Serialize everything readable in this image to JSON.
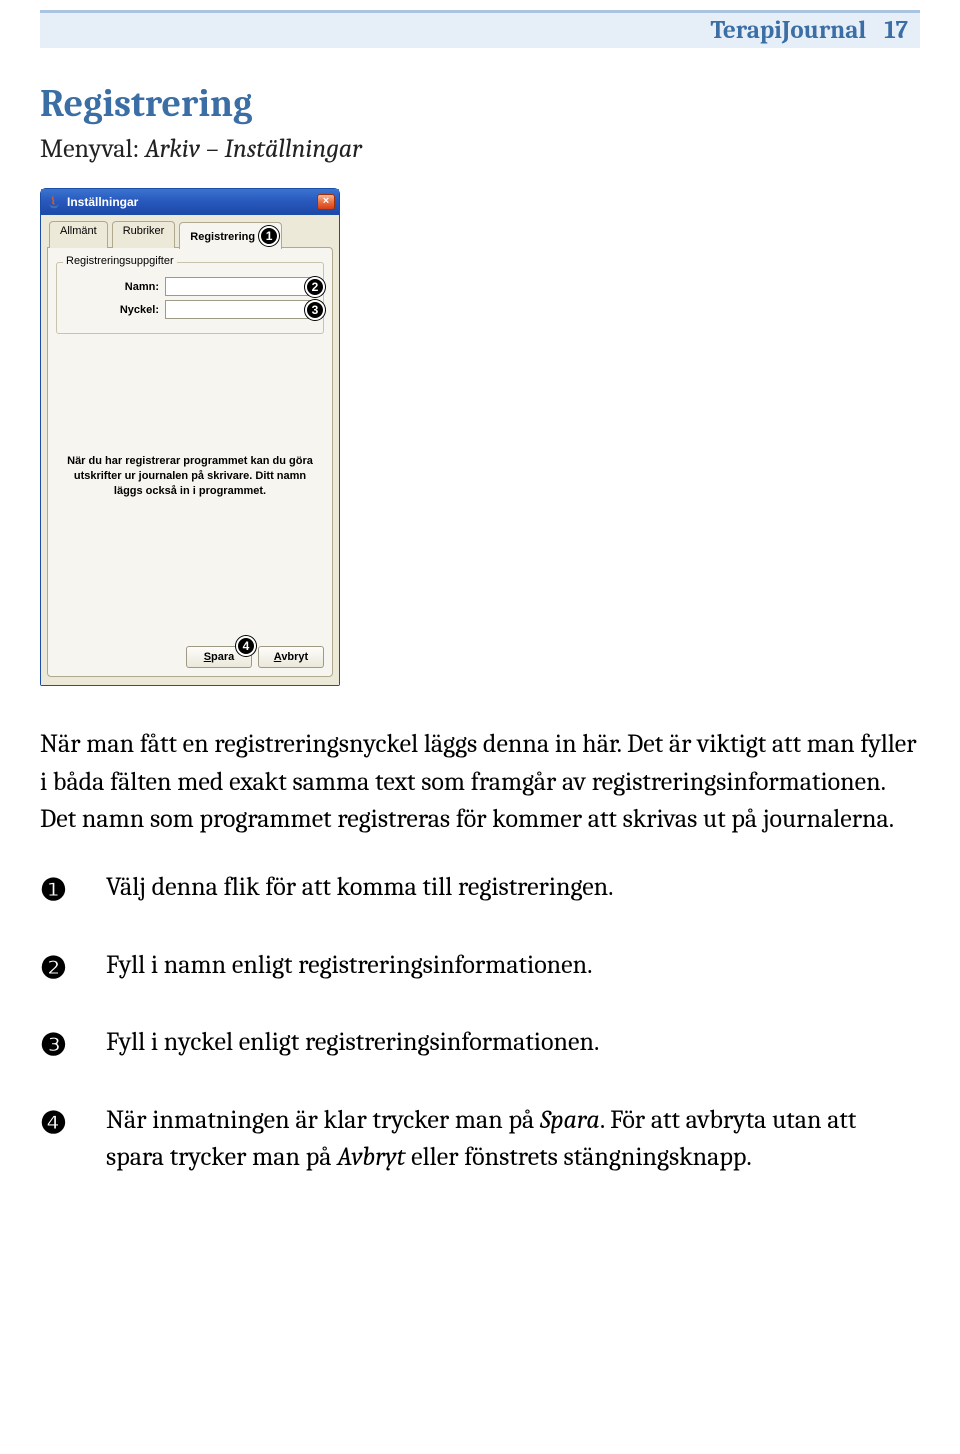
{
  "header": {
    "title": "TerapiJournal",
    "page_number": "17"
  },
  "section": {
    "title": "Registrering",
    "menu_prefix": "Menyval: ",
    "menu_path": "Arkiv – Inställningar"
  },
  "dialog": {
    "window_title": "Inställningar",
    "close_icon": "×",
    "tabs": {
      "general": "Allmänt",
      "headings": "Rubriker",
      "registration": "Registrering"
    },
    "group_legend": "Registreringsuppgifter",
    "fields": {
      "name_label": "Namn:",
      "name_value": "",
      "key_label": "Nyckel:",
      "key_value": ""
    },
    "info_text": "När du har registrerar programmet kan du göra utskrifter ur journalen på skrivare. Ditt namn läggs också in i programmet.",
    "buttons": {
      "save": "Spara",
      "cancel": "Avbryt"
    },
    "callouts": {
      "tab": "1",
      "name": "2",
      "key": "3",
      "save": "4"
    }
  },
  "body_paragraph": "När man fått en registreringsnyckel läggs denna in här. Det är viktigt att man fyller i båda fälten med exakt samma text som framgår av registreringsinformationen. Det namn som programmet registreras för kommer att skrivas ut på journalerna.",
  "steps": [
    {
      "num": "❶",
      "text": "Välj denna flik för att komma till registreringen."
    },
    {
      "num": "❷",
      "text": "Fyll i namn enligt registreringsinformationen."
    },
    {
      "num": "❸",
      "text": "Fyll i nyckel enligt registreringsinformationen."
    },
    {
      "num": "❹",
      "text_pre": "När inmatningen är klar trycker man på ",
      "text_em1": "Spara",
      "text_mid": ". För att avbryta utan att spara trycker man på ",
      "text_em2": "Avbryt",
      "text_post": " eller fönstrets stängningsknapp."
    }
  ]
}
